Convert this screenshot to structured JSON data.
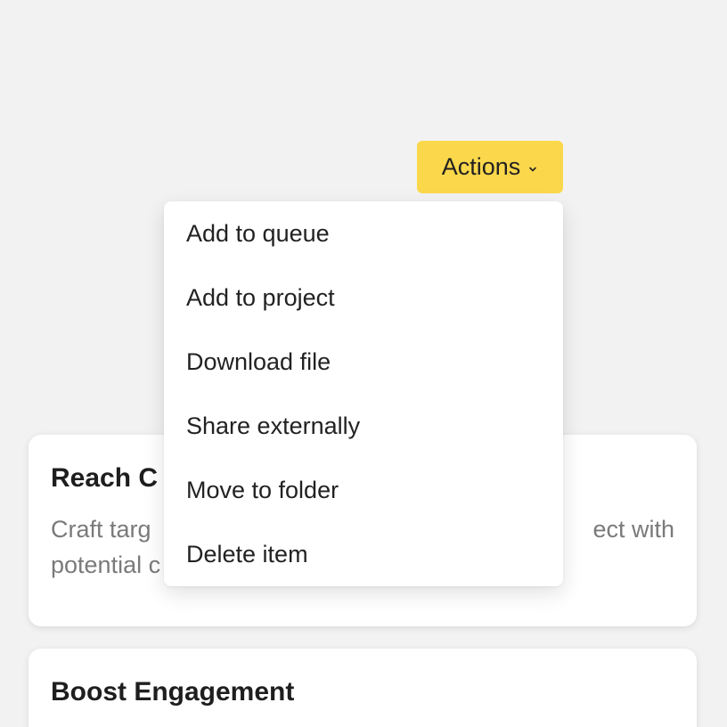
{
  "actions": {
    "label": "Actions",
    "icon": "chevron-down-icon"
  },
  "menu": {
    "items": [
      {
        "label": "Add to queue"
      },
      {
        "label": "Add to project"
      },
      {
        "label": "Download file"
      },
      {
        "label": "Share externally"
      },
      {
        "label": "Move to folder"
      },
      {
        "label": "Delete item"
      }
    ]
  },
  "cards": [
    {
      "title": "Reach C",
      "description_line1": "Craft targ",
      "description_line1_end": "ect with",
      "description_line2": "potential c"
    },
    {
      "title": "Boost Engagement"
    }
  ],
  "colors": {
    "background": "#f2f2f2",
    "accent": "#fbd84b",
    "card": "#ffffff",
    "muted_text": "#7a7a7a"
  }
}
